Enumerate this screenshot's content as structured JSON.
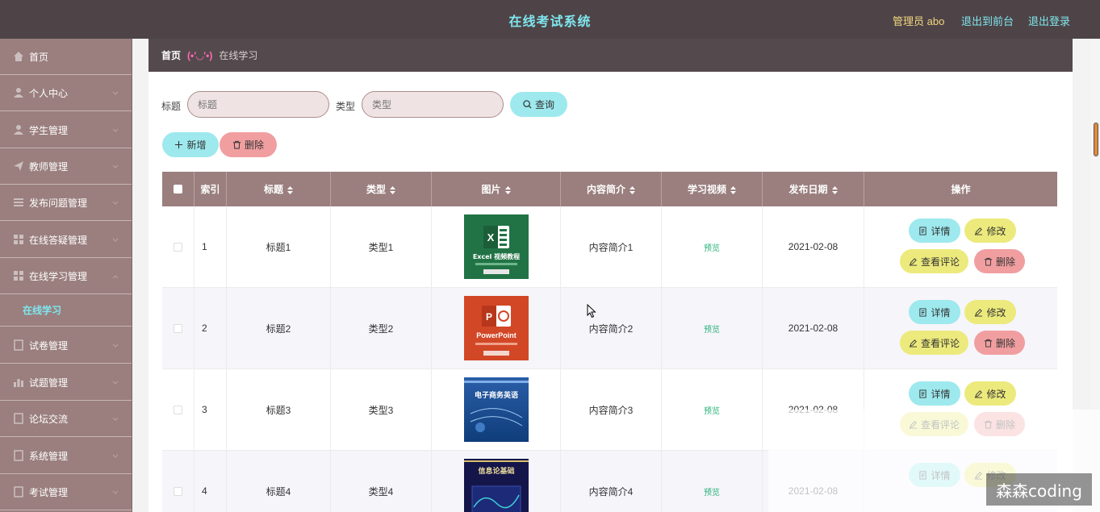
{
  "header": {
    "title": "在线考试系统",
    "admin_label": "管理员 abo",
    "front_link": "退出到前台",
    "logout_link": "退出登录"
  },
  "sidebar": {
    "items": [
      {
        "label": "首页",
        "icon": "home-icon"
      },
      {
        "label": "个人中心",
        "icon": "user-icon"
      },
      {
        "label": "学生管理",
        "icon": "user-icon"
      },
      {
        "label": "教师管理",
        "icon": "send-icon"
      },
      {
        "label": "发布问题管理",
        "icon": "list-icon"
      },
      {
        "label": "在线答疑管理",
        "icon": "grid-icon"
      },
      {
        "label": "在线学习管理",
        "icon": "grid-icon"
      },
      {
        "label": "试卷管理",
        "icon": "doc-icon"
      },
      {
        "label": "试题管理",
        "icon": "chart-icon"
      },
      {
        "label": "论坛交流",
        "icon": "doc-icon"
      },
      {
        "label": "系统管理",
        "icon": "doc-icon"
      },
      {
        "label": "考试管理",
        "icon": "doc-icon"
      }
    ],
    "active_sub": "在线学习"
  },
  "breadcrumb": {
    "home": "首页",
    "separator": "(•'◡'•)",
    "current": "在线学习"
  },
  "search": {
    "title_label": "标题",
    "title_placeholder": "标题",
    "type_label": "类型",
    "type_placeholder": "类型",
    "query_button": "查询"
  },
  "toolbar": {
    "add_button": "新增",
    "delete_button": "删除"
  },
  "table": {
    "headers": [
      "索引",
      "标题",
      "类型",
      "图片",
      "内容简介",
      "学习视频",
      "发布日期",
      "操作"
    ],
    "rows": [
      {
        "index": "1",
        "title": "标题1",
        "type": "类型1",
        "image": "Excel 视频教程",
        "intro": "内容简介1",
        "video": "预览",
        "date": "2021-02-08"
      },
      {
        "index": "2",
        "title": "标题2",
        "type": "类型2",
        "image": "PowerPoint",
        "intro": "内容简介2",
        "video": "预览",
        "date": "2021-02-08"
      },
      {
        "index": "3",
        "title": "标题3",
        "type": "类型3",
        "image": "电子商务英语",
        "intro": "内容简介3",
        "video": "预览",
        "date": "2021-02-08"
      },
      {
        "index": "4",
        "title": "标题4",
        "type": "类型4",
        "image": "信息论基础",
        "intro": "内容简介4",
        "video": "预览",
        "date": "2021-02-08"
      }
    ],
    "ops": {
      "detail": "详情",
      "edit": "修改",
      "comment": "查看评论",
      "delete": "删除"
    }
  },
  "watermark": "森森coding",
  "colors": {
    "header_bg": "#4e4447",
    "sidebar_bg": "#9a7f7e",
    "accent_cyan": "#9de9ee",
    "accent_yellow": "#ecea7c",
    "accent_red": "#f19ea0"
  }
}
